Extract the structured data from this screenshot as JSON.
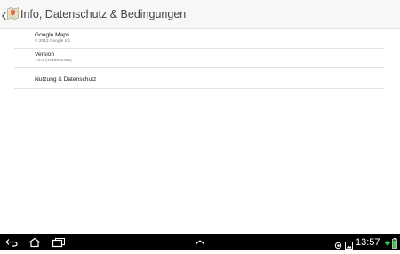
{
  "header": {
    "title": "Info, Datenschutz & Bedingungen",
    "icon": "google-maps-icon"
  },
  "list": {
    "items": [
      {
        "title": "Google Maps",
        "subtitle": "© 2013 Google Inc."
      },
      {
        "title": "Version",
        "subtitle": "7.2.0 (4702001401)"
      },
      {
        "title": "Nutzung & Datenschutz"
      }
    ]
  },
  "systembar": {
    "time": "13:57",
    "icons": [
      "back-icon",
      "home-icon",
      "recent-apps-icon",
      "expand-up-icon",
      "location-icon",
      "screenshot-icon",
      "wifi-icon",
      "battery-icon"
    ]
  },
  "colors": {
    "actionbar_bg": "#f7f7f7",
    "title_text": "#444444",
    "divider": "#e3e3e3",
    "systembar_bg": "#000000",
    "wifi_green": "#3fbf4c",
    "battery_green": "#4fd14f"
  }
}
